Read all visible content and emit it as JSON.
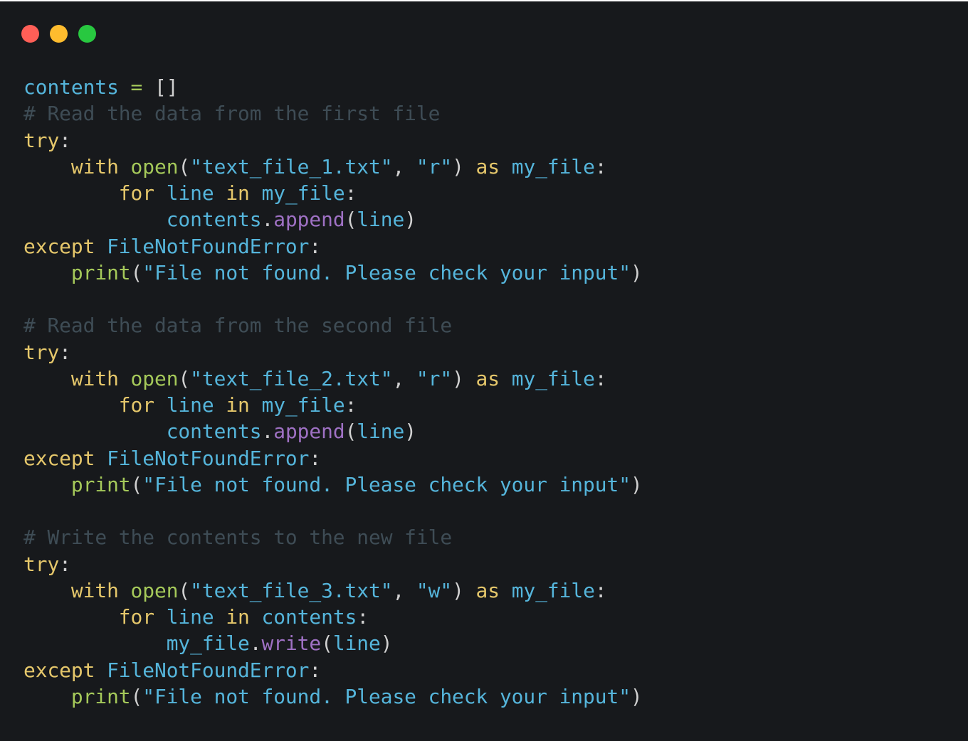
{
  "window": {
    "controls": [
      {
        "name": "close",
        "color": "#ff5f57"
      },
      {
        "name": "minimize",
        "color": "#febc2e"
      },
      {
        "name": "maximize",
        "color": "#28c840"
      }
    ]
  },
  "colors": {
    "background": "#17191c",
    "keyword": "#e5c76b",
    "builtin": "#a5c95a",
    "identifier": "#55b5db",
    "method": "#9f71c4",
    "comment": "#3e4c55",
    "punctuation": "#d0d0d0"
  },
  "code": {
    "language": "python",
    "lines": [
      [
        {
          "t": "id",
          "v": "contents"
        },
        {
          "t": "pn",
          "v": " "
        },
        {
          "t": "op",
          "v": "="
        },
        {
          "t": "pn",
          "v": " []"
        }
      ],
      [
        {
          "t": "cm",
          "v": "# Read the data from the first file"
        }
      ],
      [
        {
          "t": "kw",
          "v": "try"
        },
        {
          "t": "pn",
          "v": ":"
        }
      ],
      [
        {
          "t": "pn",
          "v": "    "
        },
        {
          "t": "kw",
          "v": "with"
        },
        {
          "t": "pn",
          "v": " "
        },
        {
          "t": "fn",
          "v": "open"
        },
        {
          "t": "pn",
          "v": "("
        },
        {
          "t": "str",
          "v": "\"text_file_1.txt\""
        },
        {
          "t": "pn",
          "v": ", "
        },
        {
          "t": "str",
          "v": "\"r\""
        },
        {
          "t": "pn",
          "v": ") "
        },
        {
          "t": "kw",
          "v": "as"
        },
        {
          "t": "pn",
          "v": " "
        },
        {
          "t": "id",
          "v": "my_file"
        },
        {
          "t": "pn",
          "v": ":"
        }
      ],
      [
        {
          "t": "pn",
          "v": "        "
        },
        {
          "t": "kw",
          "v": "for"
        },
        {
          "t": "pn",
          "v": " "
        },
        {
          "t": "id",
          "v": "line"
        },
        {
          "t": "pn",
          "v": " "
        },
        {
          "t": "kw",
          "v": "in"
        },
        {
          "t": "pn",
          "v": " "
        },
        {
          "t": "id",
          "v": "my_file"
        },
        {
          "t": "pn",
          "v": ":"
        }
      ],
      [
        {
          "t": "pn",
          "v": "            "
        },
        {
          "t": "id",
          "v": "contents"
        },
        {
          "t": "pn",
          "v": "."
        },
        {
          "t": "mth",
          "v": "append"
        },
        {
          "t": "pn",
          "v": "("
        },
        {
          "t": "id",
          "v": "line"
        },
        {
          "t": "pn",
          "v": ")"
        }
      ],
      [
        {
          "t": "kw",
          "v": "except"
        },
        {
          "t": "pn",
          "v": " "
        },
        {
          "t": "id",
          "v": "FileNotFoundError"
        },
        {
          "t": "pn",
          "v": ":"
        }
      ],
      [
        {
          "t": "pn",
          "v": "    "
        },
        {
          "t": "fn",
          "v": "print"
        },
        {
          "t": "pn",
          "v": "("
        },
        {
          "t": "str",
          "v": "\"File not found. Please check your input\""
        },
        {
          "t": "pn",
          "v": ")"
        }
      ],
      [],
      [
        {
          "t": "cm",
          "v": "# Read the data from the second file"
        }
      ],
      [
        {
          "t": "kw",
          "v": "try"
        },
        {
          "t": "pn",
          "v": ":"
        }
      ],
      [
        {
          "t": "pn",
          "v": "    "
        },
        {
          "t": "kw",
          "v": "with"
        },
        {
          "t": "pn",
          "v": " "
        },
        {
          "t": "fn",
          "v": "open"
        },
        {
          "t": "pn",
          "v": "("
        },
        {
          "t": "str",
          "v": "\"text_file_2.txt\""
        },
        {
          "t": "pn",
          "v": ", "
        },
        {
          "t": "str",
          "v": "\"r\""
        },
        {
          "t": "pn",
          "v": ") "
        },
        {
          "t": "kw",
          "v": "as"
        },
        {
          "t": "pn",
          "v": " "
        },
        {
          "t": "id",
          "v": "my_file"
        },
        {
          "t": "pn",
          "v": ":"
        }
      ],
      [
        {
          "t": "pn",
          "v": "        "
        },
        {
          "t": "kw",
          "v": "for"
        },
        {
          "t": "pn",
          "v": " "
        },
        {
          "t": "id",
          "v": "line"
        },
        {
          "t": "pn",
          "v": " "
        },
        {
          "t": "kw",
          "v": "in"
        },
        {
          "t": "pn",
          "v": " "
        },
        {
          "t": "id",
          "v": "my_file"
        },
        {
          "t": "pn",
          "v": ":"
        }
      ],
      [
        {
          "t": "pn",
          "v": "            "
        },
        {
          "t": "id",
          "v": "contents"
        },
        {
          "t": "pn",
          "v": "."
        },
        {
          "t": "mth",
          "v": "append"
        },
        {
          "t": "pn",
          "v": "("
        },
        {
          "t": "id",
          "v": "line"
        },
        {
          "t": "pn",
          "v": ")"
        }
      ],
      [
        {
          "t": "kw",
          "v": "except"
        },
        {
          "t": "pn",
          "v": " "
        },
        {
          "t": "id",
          "v": "FileNotFoundError"
        },
        {
          "t": "pn",
          "v": ":"
        }
      ],
      [
        {
          "t": "pn",
          "v": "    "
        },
        {
          "t": "fn",
          "v": "print"
        },
        {
          "t": "pn",
          "v": "("
        },
        {
          "t": "str",
          "v": "\"File not found. Please check your input\""
        },
        {
          "t": "pn",
          "v": ")"
        }
      ],
      [],
      [
        {
          "t": "cm",
          "v": "# Write the contents to the new file"
        }
      ],
      [
        {
          "t": "kw",
          "v": "try"
        },
        {
          "t": "pn",
          "v": ":"
        }
      ],
      [
        {
          "t": "pn",
          "v": "    "
        },
        {
          "t": "kw",
          "v": "with"
        },
        {
          "t": "pn",
          "v": " "
        },
        {
          "t": "fn",
          "v": "open"
        },
        {
          "t": "pn",
          "v": "("
        },
        {
          "t": "str",
          "v": "\"text_file_3.txt\""
        },
        {
          "t": "pn",
          "v": ", "
        },
        {
          "t": "str",
          "v": "\"w\""
        },
        {
          "t": "pn",
          "v": ") "
        },
        {
          "t": "kw",
          "v": "as"
        },
        {
          "t": "pn",
          "v": " "
        },
        {
          "t": "id",
          "v": "my_file"
        },
        {
          "t": "pn",
          "v": ":"
        }
      ],
      [
        {
          "t": "pn",
          "v": "        "
        },
        {
          "t": "kw",
          "v": "for"
        },
        {
          "t": "pn",
          "v": " "
        },
        {
          "t": "id",
          "v": "line"
        },
        {
          "t": "pn",
          "v": " "
        },
        {
          "t": "kw",
          "v": "in"
        },
        {
          "t": "pn",
          "v": " "
        },
        {
          "t": "id",
          "v": "contents"
        },
        {
          "t": "pn",
          "v": ":"
        }
      ],
      [
        {
          "t": "pn",
          "v": "            "
        },
        {
          "t": "id",
          "v": "my_file"
        },
        {
          "t": "pn",
          "v": "."
        },
        {
          "t": "mth",
          "v": "write"
        },
        {
          "t": "pn",
          "v": "("
        },
        {
          "t": "id",
          "v": "line"
        },
        {
          "t": "pn",
          "v": ")"
        }
      ],
      [
        {
          "t": "kw",
          "v": "except"
        },
        {
          "t": "pn",
          "v": " "
        },
        {
          "t": "id",
          "v": "FileNotFoundError"
        },
        {
          "t": "pn",
          "v": ":"
        }
      ],
      [
        {
          "t": "pn",
          "v": "    "
        },
        {
          "t": "fn",
          "v": "print"
        },
        {
          "t": "pn",
          "v": "("
        },
        {
          "t": "str",
          "v": "\"File not found. Please check your input\""
        },
        {
          "t": "pn",
          "v": ")"
        }
      ]
    ]
  }
}
